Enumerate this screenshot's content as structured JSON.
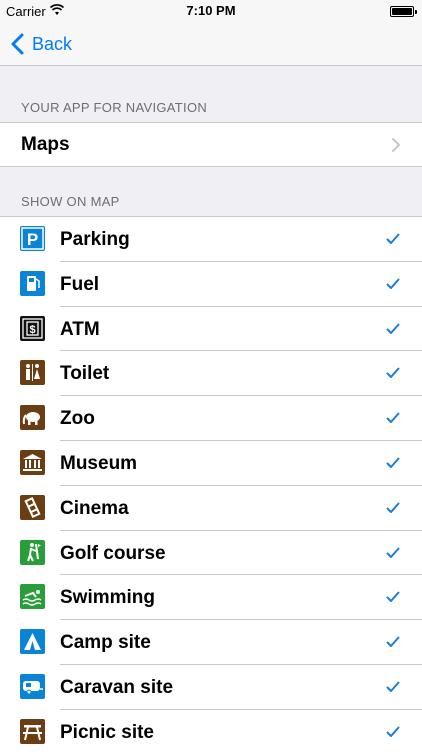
{
  "status": {
    "carrier": "Carrier",
    "time": "7:10 PM"
  },
  "nav": {
    "back_label": "Back"
  },
  "sections": {
    "navigation_header": "YOUR APP FOR NAVIGATION",
    "navigation_value": "Maps",
    "map_header": "SHOW ON MAP"
  },
  "items": [
    {
      "label": "Parking",
      "icon": "parking-icon",
      "checked": true
    },
    {
      "label": "Fuel",
      "icon": "fuel-icon",
      "checked": true
    },
    {
      "label": "ATM",
      "icon": "atm-icon",
      "checked": true
    },
    {
      "label": "Toilet",
      "icon": "toilet-icon",
      "checked": true
    },
    {
      "label": "Zoo",
      "icon": "elephant-icon",
      "checked": true
    },
    {
      "label": "Museum",
      "icon": "museum-icon",
      "checked": true
    },
    {
      "label": "Cinema",
      "icon": "cinema-icon",
      "checked": true
    },
    {
      "label": "Golf course",
      "icon": "golf-icon",
      "checked": true
    },
    {
      "label": "Swimming",
      "icon": "swimming-icon",
      "checked": true
    },
    {
      "label": "Camp site",
      "icon": "tent-icon",
      "checked": true
    },
    {
      "label": "Caravan site",
      "icon": "caravan-icon",
      "checked": true
    },
    {
      "label": "Picnic site",
      "icon": "picnic-table-icon",
      "checked": true
    }
  ],
  "colors": {
    "accent": "#007aff",
    "check": "#1a7fd6",
    "icon_blue": "#0a84d6",
    "icon_brown": "#6a3d12",
    "icon_green": "#2a9d3b"
  }
}
